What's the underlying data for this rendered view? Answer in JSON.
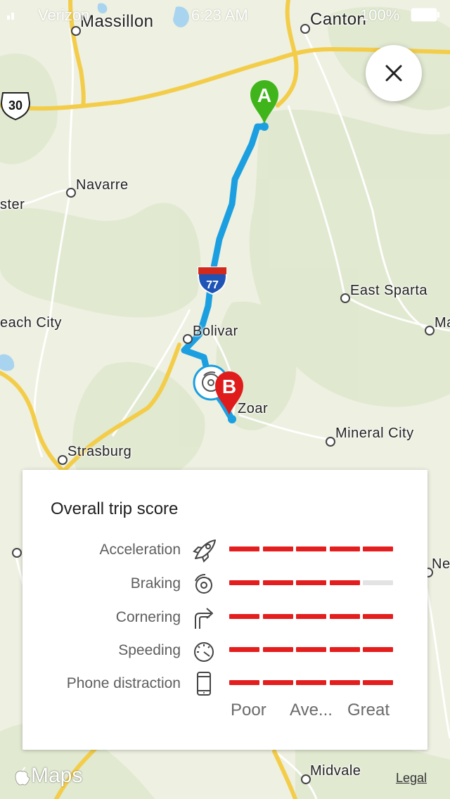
{
  "status_bar": {
    "carrier": "Verizon",
    "time": "6:23 AM",
    "battery": "100%"
  },
  "map": {
    "places": [
      {
        "name": "Massillon"
      },
      {
        "name": "Canton"
      },
      {
        "name": "Navarre"
      },
      {
        "name": "ster"
      },
      {
        "name": "East Sparta"
      },
      {
        "name": "Ma"
      },
      {
        "name": "each City"
      },
      {
        "name": "Bolivar"
      },
      {
        "name": "Zoar"
      },
      {
        "name": "Mineral City"
      },
      {
        "name": "Strasburg"
      },
      {
        "name": "Ne"
      },
      {
        "name": "Midvale"
      }
    ],
    "route_shield": "30",
    "interstate_shield": "77",
    "marker_start": "A",
    "marker_end": "B",
    "attribution": "Maps",
    "legal": "Legal"
  },
  "card": {
    "title": "Overall trip score",
    "rows": [
      {
        "label": "Acceleration",
        "icon": "rocket-icon",
        "level": 5
      },
      {
        "label": "Braking",
        "icon": "brake-icon",
        "level": 4
      },
      {
        "label": "Cornering",
        "icon": "turn-right-icon",
        "level": 5
      },
      {
        "label": "Speeding",
        "icon": "speedometer-icon",
        "level": 5
      },
      {
        "label": "Phone distraction",
        "icon": "phone-icon",
        "level": 5
      }
    ],
    "scale": {
      "low": "Poor",
      "mid": "Ave...",
      "high": "Great"
    },
    "max_level": 5
  },
  "colors": {
    "bar_filled": "#e41e1e",
    "bar_empty": "#e3e3e3",
    "route": "#1b9fe0",
    "marker_a": "#3fb51b",
    "marker_b": "#e01b1b"
  }
}
